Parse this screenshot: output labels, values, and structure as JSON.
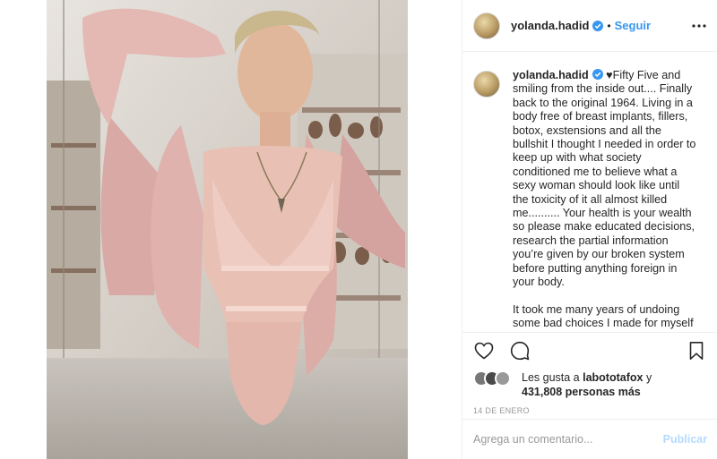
{
  "post": {
    "username": "yolanda.hadid",
    "follow_label": "Seguir",
    "dot": "•",
    "caption_username": "yolanda.hadid",
    "caption_text": "♥Fifty Five and smiling from the inside out.... Finally back to the original 1964. Living in a body free of breast implants, fillers, botox, exstensions and all the bullshit I thought I needed in order to keep up with what society conditioned me to believe what a sexy woman should look like until the toxicity of it all almost killed me.......... Your health is your wealth so please make educated decisions, research the partial information you’re given by our broken system before putting anything foreign in your body.\n\nIt took me many years of undoing some bad choices I made for myself before I finally found the freedom to",
    "likes_prefix": "Les gusta a ",
    "likes_user": "labototafox",
    "likes_mid": " y",
    "likes_count": "431,808 personas más",
    "date": "14 DE ENERO",
    "comment_placeholder": "Agrega un comentario...",
    "publish_label": "Publicar"
  },
  "icons": {
    "verified": "verified-badge-icon",
    "more": "more-options-icon",
    "like": "heart-icon",
    "comment": "comment-bubble-icon",
    "save": "bookmark-icon"
  },
  "colors": {
    "accent": "#3897f0",
    "publish_disabled": "#b3dbff",
    "muted": "#999999",
    "border": "#efefef"
  }
}
